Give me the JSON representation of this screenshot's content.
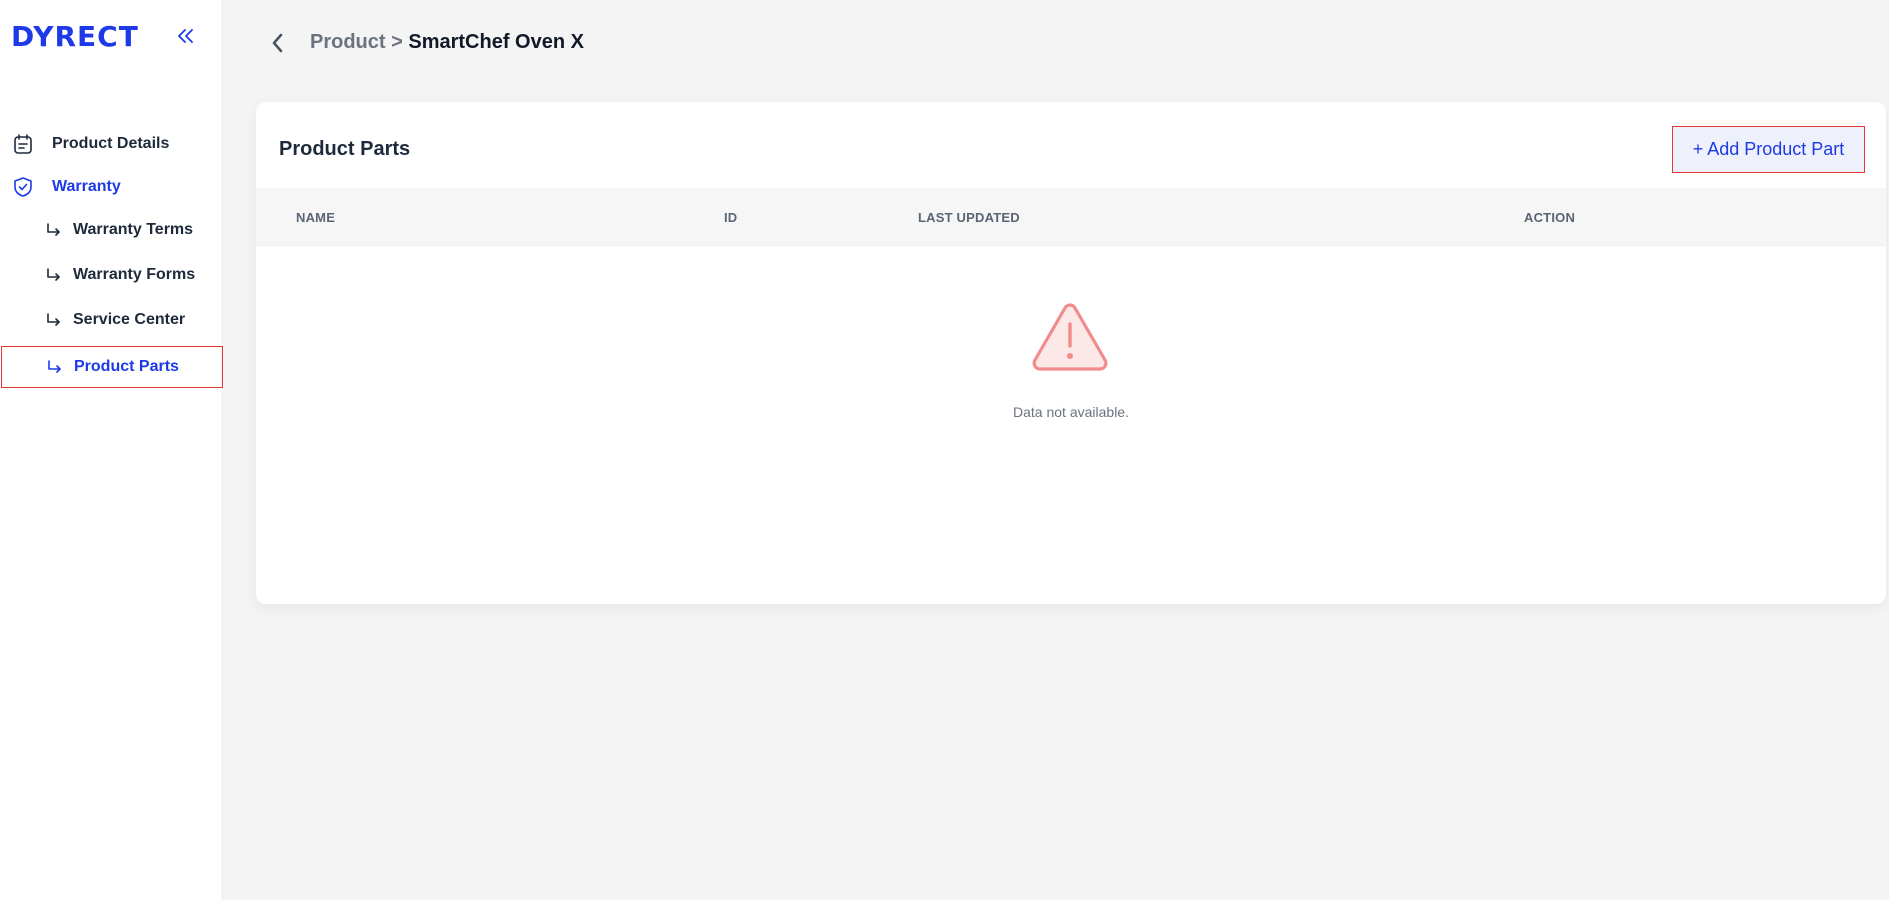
{
  "app": {
    "logo_text": "DYRECT",
    "brand_color": "#1d3ae6"
  },
  "sidebar": {
    "collapse_icon": "double-chevron-left-icon",
    "items": [
      {
        "label": "Product Details",
        "icon": "calendar-icon",
        "state": "default"
      },
      {
        "label": "Warranty",
        "icon": "shield-check-icon",
        "state": "active"
      },
      {
        "label": "Warranty Terms",
        "icon": "sub-arrow-icon",
        "state": "default"
      },
      {
        "label": "Warranty Forms",
        "icon": "sub-arrow-icon",
        "state": "default"
      },
      {
        "label": "Service Center",
        "icon": "sub-arrow-icon",
        "state": "default"
      },
      {
        "label": "Product Parts",
        "icon": "sub-arrow-icon",
        "state": "selected"
      }
    ]
  },
  "header": {
    "back_icon": "chevron-left-icon",
    "breadcrumb": {
      "parent": "Product",
      "separator": " > ",
      "current": "SmartChef Oven X"
    }
  },
  "main": {
    "card_title": "Product Parts",
    "add_button_label": "+ Add Product Part",
    "table": {
      "columns": [
        "NAME",
        "ID",
        "LAST UPDATED",
        "ACTION"
      ],
      "rows": []
    },
    "empty_state": {
      "icon": "warning-triangle-icon",
      "text": "Data not available."
    },
    "colors": {
      "highlight_border": "#e53935",
      "warning_icon": "#f28b8b"
    }
  }
}
